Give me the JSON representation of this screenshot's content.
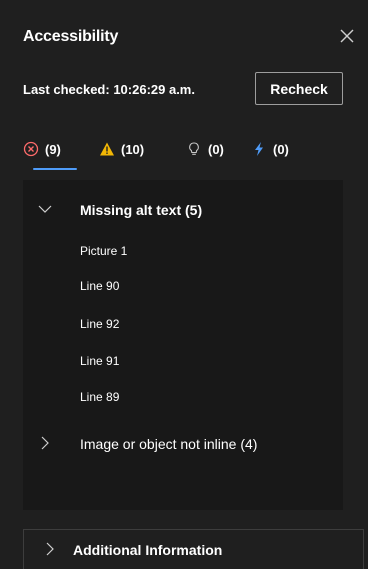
{
  "panel": {
    "title": "Accessibility",
    "close_label": "Close"
  },
  "check": {
    "last_checked": "Last checked: 10:26:29 a.m.",
    "recheck_label": "Recheck"
  },
  "tabs": [
    {
      "name": "errors",
      "count": "(9)",
      "icon": "error-circle-icon",
      "color": "#ff6b6b"
    },
    {
      "name": "warnings",
      "count": "(10)",
      "icon": "warning-triangle-icon",
      "color": "#f2b705"
    },
    {
      "name": "tips",
      "count": "(0)",
      "icon": "lightbulb-icon",
      "color": "#c8c8c8"
    },
    {
      "name": "intelligent",
      "count": "(0)",
      "icon": "lightning-icon",
      "color": "#4f9cf9"
    }
  ],
  "groups": [
    {
      "label": "Missing alt text (5)",
      "expanded": true,
      "items": [
        "Picture 1",
        "Line 90",
        "Line 92",
        "Line 91",
        "Line 89"
      ]
    },
    {
      "label": "Image or object not inline (4)",
      "expanded": false,
      "items": []
    }
  ],
  "footer": {
    "label": "Additional Information"
  },
  "colors": {
    "background": "#1f1f1f",
    "content_background": "#181818",
    "accent": "#4f9cf9",
    "text": "#ffffff"
  }
}
